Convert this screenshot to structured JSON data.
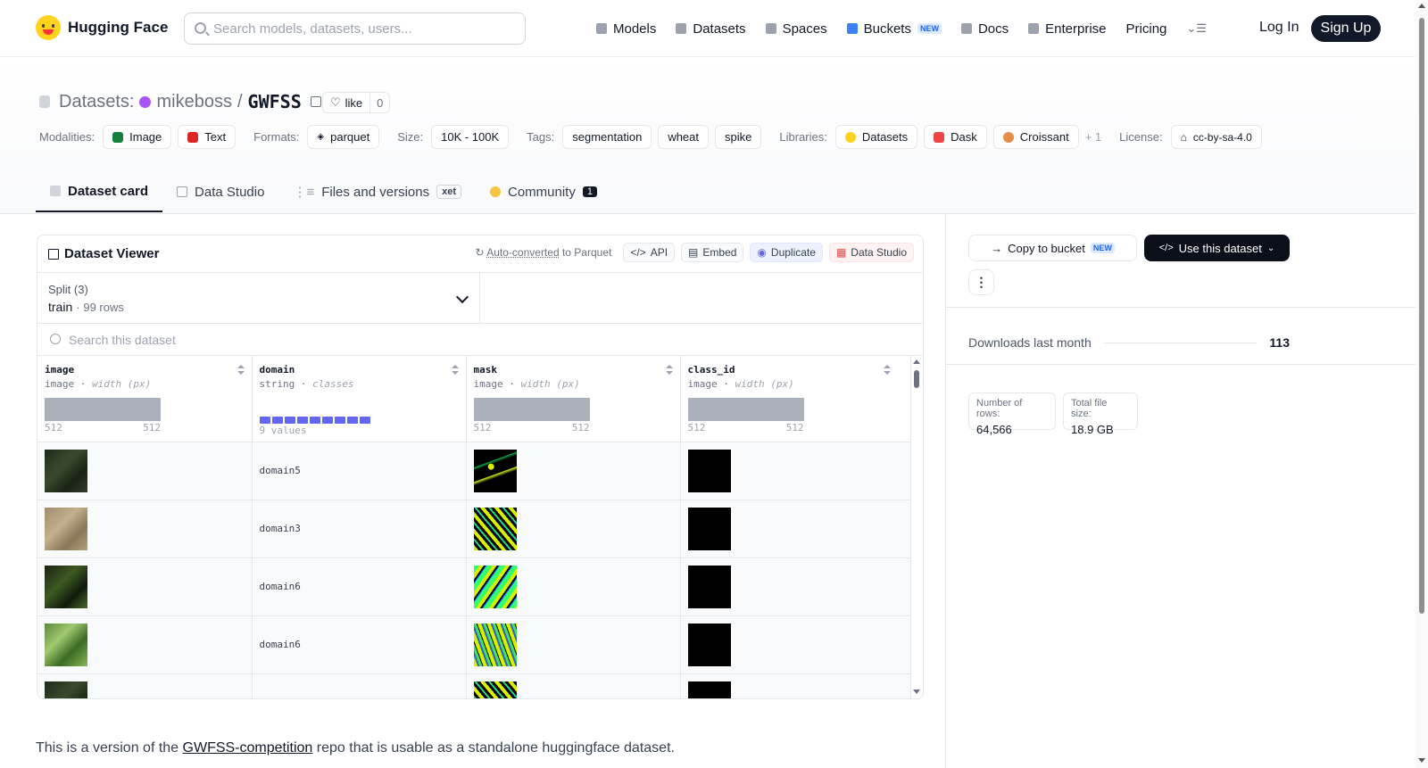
{
  "nav": {
    "brand": "Hugging Face",
    "search_placeholder": "Search models, datasets, users...",
    "items": [
      {
        "label": "Models",
        "icon": "models-icon"
      },
      {
        "label": "Datasets",
        "icon": "datasets-icon"
      },
      {
        "label": "Spaces",
        "icon": "spaces-icon"
      },
      {
        "label": "Buckets",
        "icon": "buckets-icon",
        "badge": "NEW"
      },
      {
        "label": "Docs",
        "icon": "docs-icon"
      },
      {
        "label": "Enterprise",
        "icon": "enterprise-icon"
      },
      {
        "label": "Pricing"
      }
    ],
    "login": "Log In",
    "signup": "Sign Up"
  },
  "header": {
    "prefix": "Datasets:",
    "owner": "mikeboss",
    "separator": "/",
    "name": "GWFSS",
    "like_label": "like",
    "like_count": "0",
    "modalities_label": "Modalities:",
    "modalities": [
      "Image",
      "Text"
    ],
    "formats_label": "Formats:",
    "formats": [
      "parquet"
    ],
    "size_label": "Size:",
    "size": "10K - 100K",
    "tags_label": "Tags:",
    "tags": [
      "segmentation",
      "wheat",
      "spike"
    ],
    "libraries_label": "Libraries:",
    "libraries": [
      "Datasets",
      "Dask",
      "Croissant"
    ],
    "libraries_more": "+ 1",
    "license_label": "License:",
    "license": "cc-by-sa-4.0"
  },
  "tabs": [
    {
      "label": "Dataset card",
      "active": true
    },
    {
      "label": "Data Studio"
    },
    {
      "label": "Files and versions",
      "badge": "xet"
    },
    {
      "label": "Community",
      "count": "1"
    }
  ],
  "viewer": {
    "title": "Dataset Viewer",
    "auto_converted_link": "Auto-converted",
    "auto_converted_rest": " to Parquet",
    "buttons": [
      "API",
      "Embed",
      "Duplicate",
      "Data Studio"
    ],
    "split_label": "Split (3)",
    "split_value": "train",
    "split_rows": "99 rows",
    "search_placeholder": "Search this dataset",
    "columns": [
      {
        "name": "image",
        "type": "image",
        "stat": "width (px)",
        "min": "512",
        "max": "512"
      },
      {
        "name": "domain",
        "type": "string",
        "stat": "classes",
        "values_label": "9 values"
      },
      {
        "name": "mask",
        "type": "image",
        "stat": "width (px)",
        "min": "512",
        "max": "512"
      },
      {
        "name": "class_id",
        "type": "image",
        "stat": "width (px)",
        "min": "512",
        "max": "512"
      }
    ],
    "rows": [
      {
        "domain": "domain5"
      },
      {
        "domain": "domain3"
      },
      {
        "domain": "domain6"
      },
      {
        "domain": "domain6"
      },
      {
        "domain": ""
      }
    ]
  },
  "description": {
    "before": "This is a version of the ",
    "link": "GWFSS-competition",
    "after": " repo that is usable as a standalone huggingface dataset."
  },
  "sidebar": {
    "copy_to_bucket": "Copy to bucket",
    "copy_badge": "NEW",
    "use_dataset": "Use this dataset",
    "downloads_label": "Downloads last month",
    "downloads_value": "113",
    "rows_label": "Number of rows:",
    "rows_value": "64,566",
    "size_label": "Total file size:",
    "size_value": "18.9 GB"
  }
}
